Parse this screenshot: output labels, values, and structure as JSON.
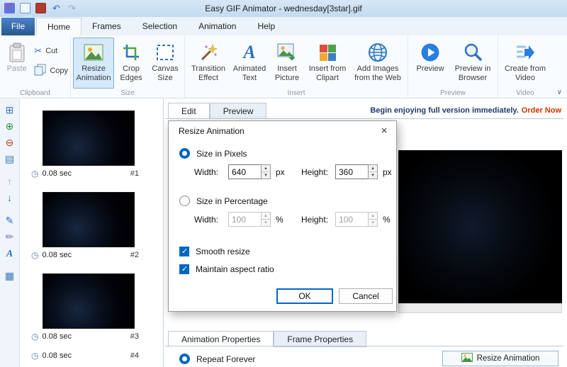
{
  "window": {
    "title": "Easy GIF Animator - wednesday[3star].gif"
  },
  "titlebar": {
    "icons": [
      "app-icon",
      "new-icon",
      "save-icon",
      "undo-icon",
      "redo-icon"
    ]
  },
  "menu": {
    "file_label": "File",
    "tabs": [
      "Home",
      "Frames",
      "Selection",
      "Animation",
      "Help"
    ],
    "active_tab": "Home"
  },
  "ribbon": {
    "groups": [
      {
        "label": "Clipboard",
        "items": [
          {
            "label": "Paste",
            "icon": "paste-icon",
            "state": "disabled"
          },
          {
            "label": "Cut",
            "icon": "cut-icon"
          },
          {
            "label": "Copy",
            "icon": "copy-icon"
          }
        ]
      },
      {
        "label": "Size",
        "items": [
          {
            "label": "Resize Animation",
            "icon": "resize-animation-icon",
            "state": "selected"
          },
          {
            "label": "Crop Edges",
            "icon": "crop-edges-icon"
          },
          {
            "label": "Canvas Size",
            "icon": "canvas-size-icon"
          }
        ]
      },
      {
        "label": "Insert",
        "items": [
          {
            "label": "Transition Effect",
            "icon": "transition-effect-icon"
          },
          {
            "label": "Animated Text",
            "icon": "animated-text-icon"
          },
          {
            "label": "Insert Picture",
            "icon": "insert-picture-icon"
          },
          {
            "label": "Insert from Clipart",
            "icon": "insert-from-clipart-icon"
          },
          {
            "label": "Add Images from the Web",
            "icon": "add-images-from-web-icon"
          }
        ]
      },
      {
        "label": "Preview",
        "items": [
          {
            "label": "Preview",
            "icon": "preview-icon"
          },
          {
            "label": "Preview in Browser",
            "icon": "preview-in-browser-icon"
          }
        ]
      },
      {
        "label": "Video",
        "items": [
          {
            "label": "Create from Video",
            "icon": "create-from-video-icon"
          }
        ]
      }
    ]
  },
  "left_toolbar": {
    "icons": [
      "add-frames-icon",
      "insert-frame-icon",
      "delete-frame-icon",
      "duplicate-frame-icon",
      "move-frame-up-icon",
      "move-frame-down-icon",
      "edit-frame-icon",
      "draw-icon",
      "add-text-icon",
      "manage-frames-icon"
    ]
  },
  "frames": {
    "items": [
      {
        "duration": "0.08 sec",
        "index": "#1"
      },
      {
        "duration": "0.08 sec",
        "index": "#2"
      },
      {
        "duration": "0.08 sec",
        "index": "#3"
      },
      {
        "duration": "0.08 sec",
        "index": "#4"
      }
    ]
  },
  "workspace": {
    "tabs": [
      "Edit",
      "Preview"
    ],
    "active_tab": "Edit",
    "promo_text": "Begin enjoying full version immediately.",
    "promo_link": "Order Now"
  },
  "dialog": {
    "title": "Resize Animation",
    "pixels": {
      "label": "Size in Pixels",
      "selected": true,
      "width_label": "Width:",
      "width_value": "640",
      "width_unit": "px",
      "height_label": "Height:",
      "height_value": "360",
      "height_unit": "px"
    },
    "percent": {
      "label": "Size in Percentage",
      "selected": false,
      "width_label": "Width:",
      "width_value": "100",
      "width_unit": "%",
      "height_label": "Height:",
      "height_value": "100",
      "height_unit": "%"
    },
    "smooth_label": "Smooth resize",
    "smooth_checked": true,
    "aspect_label": "Maintain aspect ratio",
    "aspect_checked": true,
    "ok_label": "OK",
    "cancel_label": "Cancel"
  },
  "properties": {
    "tabs": [
      "Animation Properties",
      "Frame Properties"
    ],
    "active_tab": "Animation Properties",
    "repeat_label": "Repeat Forever",
    "repeat_selected": true,
    "resize_button_label": "Resize Animation"
  },
  "colors": {
    "accent_blue": "#0067c0",
    "selection_blue": "#d5e9fb",
    "promo_navy": "#1d3d6e",
    "promo_red": "#cc3300",
    "titlebar_blue": "#c3dbf0"
  }
}
